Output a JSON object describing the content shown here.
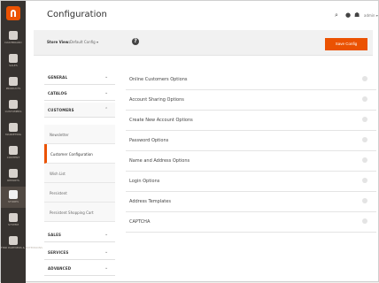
{
  "rail": {
    "logo": "magento-logo",
    "items": [
      {
        "label": "DASHBOARD",
        "icon": "dashboard-icon"
      },
      {
        "label": "SALES",
        "icon": "dollar-icon"
      },
      {
        "label": "PRODUCTS",
        "icon": "cube-icon"
      },
      {
        "label": "CUSTOMERS",
        "icon": "customers-icon"
      },
      {
        "label": "MARKETING",
        "icon": "megaphone-icon"
      },
      {
        "label": "CONTENT",
        "icon": "content-icon"
      },
      {
        "label": "REPORTS",
        "icon": "reports-icon"
      },
      {
        "label": "STORES",
        "icon": "store-icon",
        "active": true
      },
      {
        "label": "SYSTEM",
        "icon": "gear-icon"
      },
      {
        "label": "FIND PARTNERS & EXTENSIONS",
        "icon": "extensions-icon"
      }
    ]
  },
  "header": {
    "title": "Configuration",
    "search_icon": "search-icon",
    "notifications_icon": "bell-icon",
    "user_icon": "user-icon",
    "user_label": "admin ▾"
  },
  "toolbar": {
    "scope_label": "Store View:",
    "scope_value": "Default Config ▾",
    "help_glyph": "?",
    "save_label": "Save Config"
  },
  "left_panel": {
    "groups": [
      {
        "label": "GENERAL"
      },
      {
        "label": "CATALOG"
      },
      {
        "label": "CUSTOMERS"
      }
    ],
    "customers_items": [
      {
        "label": "Newsletter"
      },
      {
        "label": "Customer Configuration",
        "active": true
      },
      {
        "label": "Wish List"
      },
      {
        "label": "Persistent"
      },
      {
        "label": "Persistent Shopping Cart"
      }
    ],
    "bottom_groups": [
      {
        "label": "SALES"
      },
      {
        "label": "SERVICES"
      },
      {
        "label": "ADVANCED"
      }
    ]
  },
  "sections": [
    "Online Customers Options",
    "Account Sharing Options",
    "Create New Account Options",
    "Password Options",
    "Name and Address Options",
    "Login Options",
    "Address Templates",
    "CAPTCHA"
  ]
}
